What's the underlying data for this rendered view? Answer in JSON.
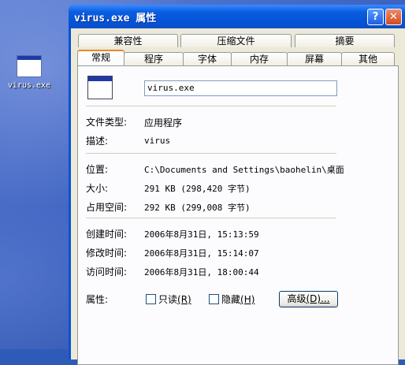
{
  "desktop": {
    "icon_label": "virus.exe"
  },
  "window": {
    "title": "virus.exe 属性",
    "help_glyph": "?",
    "close_glyph": "✕"
  },
  "tabs": {
    "row1": [
      "兼容性",
      "压缩文件",
      "摘要"
    ],
    "row2": [
      "常规",
      "程序",
      "字体",
      "内存",
      "屏幕",
      "其他"
    ],
    "active": "常规"
  },
  "general": {
    "file_name": "virus.exe",
    "file_type_label": "文件类型:",
    "file_type": "应用程序",
    "description_label": "描述:",
    "description": "virus",
    "location_label": "位置:",
    "location": "C:\\Documents and Settings\\baohelin\\桌面",
    "size_label": "大小:",
    "size": "291 KB (298,420 字节)",
    "size_on_disk_label": "占用空间:",
    "size_on_disk": "292 KB (299,008 字节)",
    "created_label": "创建时间:",
    "created": "2006年8月31日, 15:13:59",
    "modified_label": "修改时间:",
    "modified": "2006年8月31日, 15:14:07",
    "accessed_label": "访问时间:",
    "accessed": "2006年8月31日, 18:00:44",
    "attributes_label": "属性:",
    "readonly_label": "只读",
    "readonly_key": "(R)",
    "hidden_label": "隐藏",
    "hidden_key": "(H)",
    "advanced_label": "高级",
    "advanced_key": "(D)...",
    "readonly_checked": false,
    "hidden_checked": false
  }
}
